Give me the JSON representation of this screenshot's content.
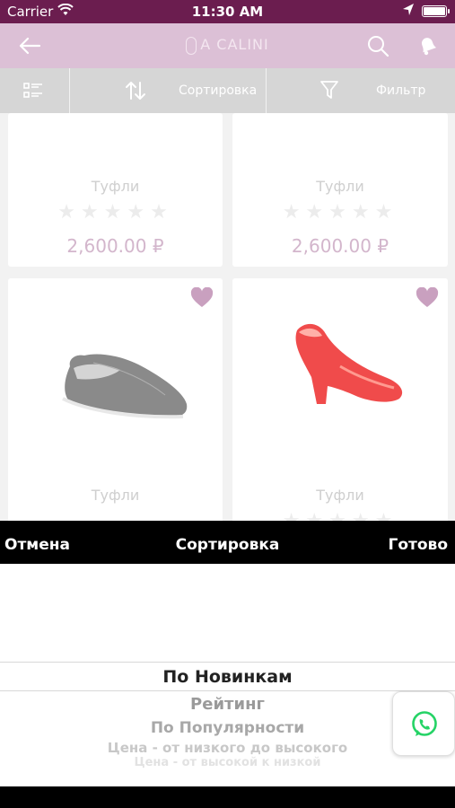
{
  "status_bar": {
    "carrier": "Carrier",
    "time": "11:30 AM"
  },
  "navbar": {
    "logo": "A CALINI"
  },
  "toolbar": {
    "sort_label": "Сортировка",
    "filter_label": "Фильтр"
  },
  "products": [
    {
      "name": "Туфли",
      "price": "2,600.00 ₽",
      "rating": 0
    },
    {
      "name": "Туфли",
      "price": "2,600.00 ₽",
      "rating": 0
    },
    {
      "name": "Туфли",
      "image": "grey slip-on shoe",
      "favorite": true
    },
    {
      "name": "Туфли",
      "image": "red patent pump",
      "favorite": true
    }
  ],
  "sort_picker": {
    "cancel_label": "Отмена",
    "title": "Сортировка",
    "done_label": "Готово",
    "options": [
      "По Новинкам",
      "Рейтинг",
      "По Популярности",
      "Цена - от низкого до высокого",
      "Цена - от высокой к низкой"
    ],
    "selected": "По Новинкам"
  },
  "icons": {
    "back": "arrow-left-icon",
    "search": "search-icon",
    "notifications": "bell-icon",
    "list_view": "list-view-icon",
    "sort": "sort-arrows-icon",
    "filter": "funnel-icon",
    "favorite": "heart-icon",
    "chat": "whatsapp-icon"
  },
  "colors": {
    "status_bar": "#6b1d4f",
    "nav_bar": "#dcc0d6",
    "toolbar": "#d6d6d6",
    "price": "#d3b6cc",
    "heart": "#c9a0bf",
    "whatsapp": "#25d366"
  }
}
